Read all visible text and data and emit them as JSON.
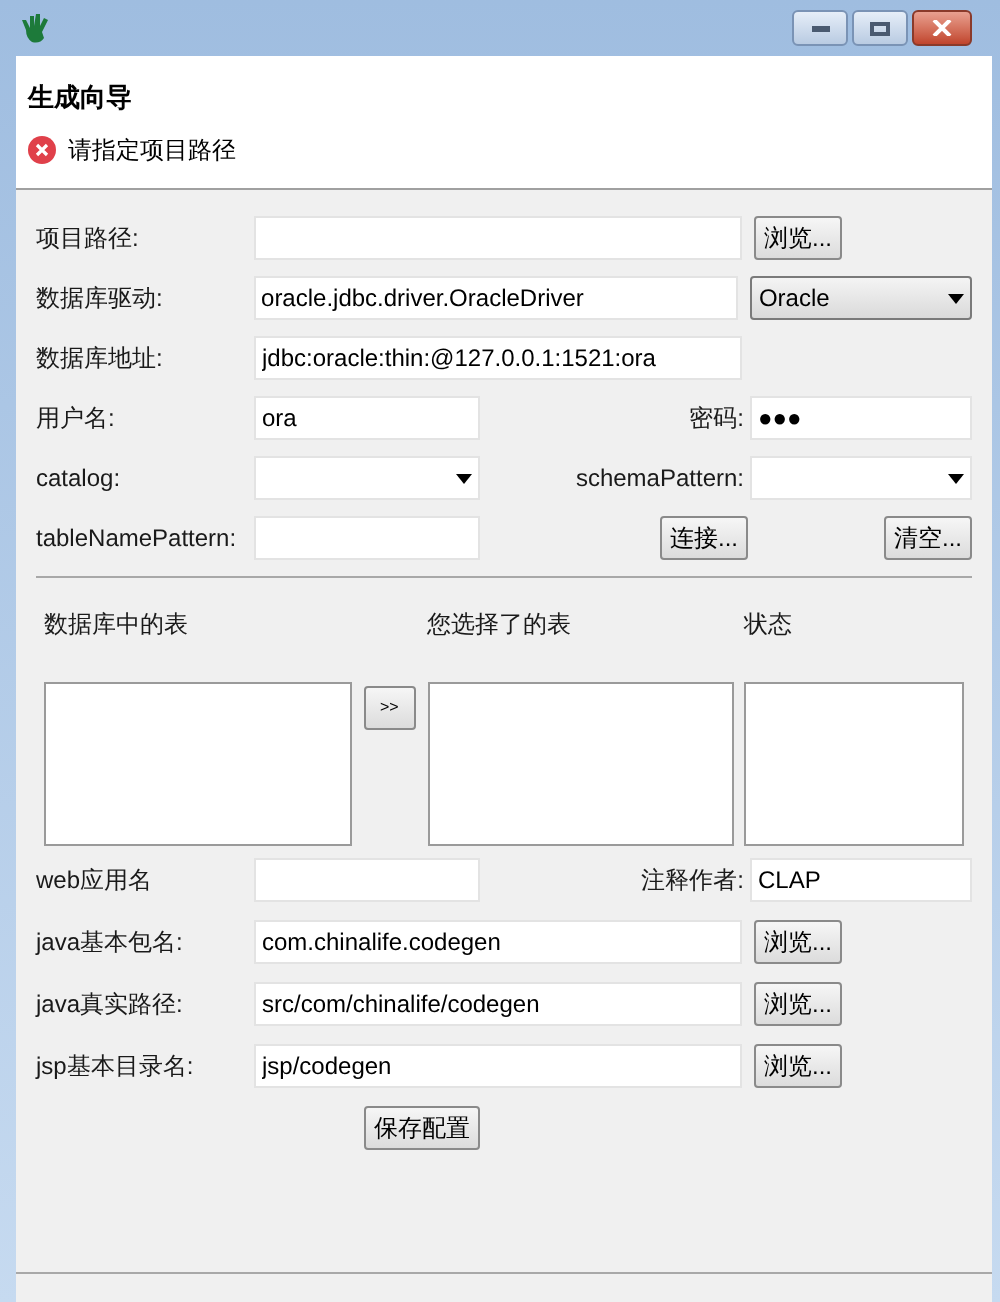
{
  "wizard": {
    "title": "生成向导",
    "message": "请指定项目路径"
  },
  "project_path": {
    "label": "项目路径:",
    "browse": "浏览..."
  },
  "db_driver": {
    "label": "数据库驱动:",
    "value": "oracle.jdbc.driver.OracleDriver",
    "db_type": "Oracle"
  },
  "db_url": {
    "label": "数据库地址:",
    "value": "jdbc:oracle:thin:@127.0.0.1:1521:ora"
  },
  "username": {
    "label": "用户名:",
    "value": "ora"
  },
  "password": {
    "label": "密码:",
    "value": "●●●"
  },
  "catalog": {
    "label": "catalog:"
  },
  "schema_pattern": {
    "label": "schemaPattern:"
  },
  "table_name_pattern": {
    "label": "tableNamePattern:"
  },
  "connect_button": "连接...",
  "clear_button": "清空...",
  "tables": {
    "available_label": "数据库中的表",
    "move_button": ">>",
    "selected_label": "您选择了的表",
    "status_label": "状态"
  },
  "web_app": {
    "label": "web应用名"
  },
  "author": {
    "label": "注释作者:",
    "value": "CLAP"
  },
  "paths": [
    {
      "label": "java基本包名:",
      "value": "com.chinalife.codegen",
      "browse": "浏览..."
    },
    {
      "label": "java真实路径:",
      "value": "src/com/chinalife/codegen",
      "browse": "浏览..."
    },
    {
      "label": "jsp基本目录名:",
      "value": "jsp/codegen",
      "browse": "浏览..."
    }
  ],
  "save_button": "保存配置"
}
